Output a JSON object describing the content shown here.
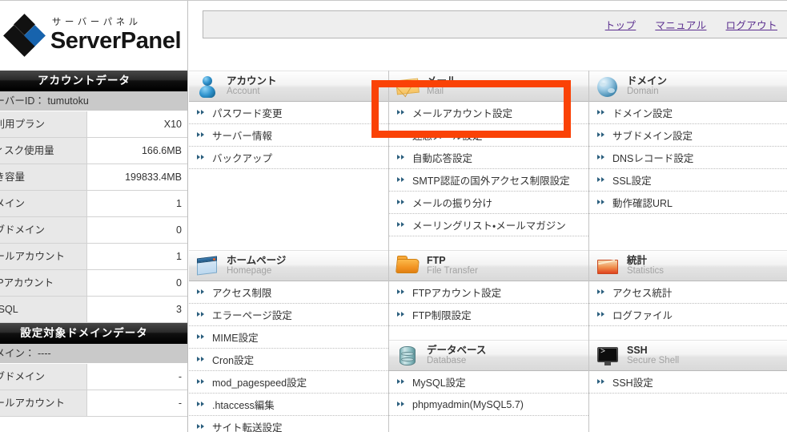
{
  "brand": {
    "kana": "サーバーパネル",
    "name": "ServerPanel"
  },
  "topbar": {
    "links": [
      {
        "label": "トップ"
      },
      {
        "label": "マニュアル"
      },
      {
        "label": "ログアウト"
      }
    ]
  },
  "sidebar": {
    "account_panel": {
      "title": "アカウントデータ",
      "server_id_label": "サーバーID：",
      "server_id_value": "tumutoku",
      "rows": [
        {
          "key": "ご利用プラン",
          "value": "X10"
        },
        {
          "key": "ディスク使用量",
          "value": "166.6MB"
        },
        {
          "key": "空き容量",
          "value": "199833.4MB"
        },
        {
          "key": "ドメイン",
          "value": "1"
        },
        {
          "key": "サブドメイン",
          "value": "0"
        },
        {
          "key": "メールアカウント",
          "value": "1"
        },
        {
          "key": "FTPアカウント",
          "value": "0"
        },
        {
          "key": "MySQL",
          "value": "3"
        }
      ]
    },
    "domain_panel": {
      "title": "設定対象ドメインデータ",
      "domain_label": "ドメイン：",
      "domain_value": "----",
      "rows": [
        {
          "key": "サブドメイン",
          "value": "-"
        },
        {
          "key": "メールアカウント",
          "value": "-"
        }
      ]
    }
  },
  "sections": {
    "account": {
      "title_ja": "アカウント",
      "title_en": "Account",
      "items": [
        {
          "label": "パスワード変更"
        },
        {
          "label": "サーバー情報"
        },
        {
          "label": "バックアップ"
        }
      ]
    },
    "mail": {
      "title_ja": "メール",
      "title_en": "Mail",
      "items": [
        {
          "label": "メールアカウント設定"
        },
        {
          "label": "迷惑メール設定"
        },
        {
          "label": "自動応答設定"
        },
        {
          "label": "SMTP認証の国外アクセス制限設定"
        },
        {
          "label": "メールの振り分け"
        },
        {
          "label": "メーリングリスト・メールマガジン"
        }
      ]
    },
    "domain": {
      "title_ja": "ドメイン",
      "title_en": "Domain",
      "items": [
        {
          "label": "ドメイン設定"
        },
        {
          "label": "サブドメイン設定"
        },
        {
          "label": "DNSレコード設定"
        },
        {
          "label": "SSL設定"
        },
        {
          "label": "動作確認URL"
        }
      ]
    },
    "homepage": {
      "title_ja": "ホームページ",
      "title_en": "Homepage",
      "items": [
        {
          "label": "アクセス制限"
        },
        {
          "label": "エラーページ設定"
        },
        {
          "label": "MIME設定"
        },
        {
          "label": "Cron設定"
        },
        {
          "label": "mod_pagespeed設定"
        },
        {
          "label": ".htaccess編集"
        },
        {
          "label": "サイト転送設定"
        }
      ]
    },
    "ftp": {
      "title_ja": "FTP",
      "title_en": "File Transfer",
      "items": [
        {
          "label": "FTPアカウント設定"
        },
        {
          "label": "FTP制限設定"
        }
      ]
    },
    "statistics": {
      "title_ja": "統計",
      "title_en": "Statistics",
      "items": [
        {
          "label": "アクセス統計"
        },
        {
          "label": "ログファイル"
        }
      ]
    },
    "database": {
      "title_ja": "データベース",
      "title_en": "Database",
      "items": [
        {
          "label": "MySQL設定"
        },
        {
          "label": "phpmyadmin(MySQL5.7)"
        }
      ]
    },
    "ssh": {
      "title_ja": "SSH",
      "title_en": "Secure Shell",
      "items": [
        {
          "label": "SSH設定"
        }
      ]
    }
  },
  "annotation": {
    "color": "#fa4206",
    "target": "メールアカウント設定"
  }
}
